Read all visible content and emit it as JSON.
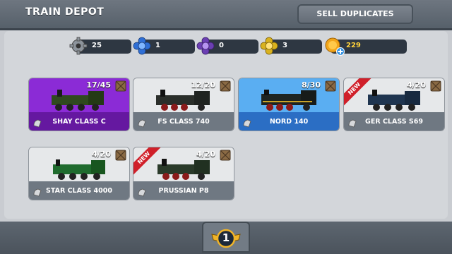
{
  "header": {
    "title": "TRAIN DEPOT",
    "sell_label": "SELL DUPLICATES"
  },
  "resources": [
    {
      "icon": "gear-icon",
      "value": "25"
    },
    {
      "icon": "blue-gem-icon",
      "value": "1"
    },
    {
      "icon": "purple-gem-icon",
      "value": "0"
    },
    {
      "icon": "gold-gem-icon",
      "value": "3"
    },
    {
      "icon": "gold-coin-icon",
      "value": "229"
    }
  ],
  "cards": [
    {
      "name": "SHAY CLASS C",
      "count": "17/45",
      "variant": "selected",
      "new": false
    },
    {
      "name": "FS CLASS 740",
      "count": "12/20",
      "variant": "grey",
      "new": false
    },
    {
      "name": "NORD 140",
      "count": "8/30",
      "variant": "blue",
      "new": false
    },
    {
      "name": "GER CLASS S69",
      "count": "4/20",
      "variant": "grey",
      "new": true
    },
    {
      "name": "STAR CLASS 4000",
      "count": "4/20",
      "variant": "grey",
      "new": false
    },
    {
      "name": "PRUSSIAN P8",
      "count": "4/20",
      "variant": "grey",
      "new": true
    }
  ],
  "new_label": "NEW",
  "footer": {
    "level": "1"
  },
  "colors": {
    "selected": "#7b1fc0",
    "blue": "#4da3ef",
    "grey_top": "#e6e8ea"
  }
}
